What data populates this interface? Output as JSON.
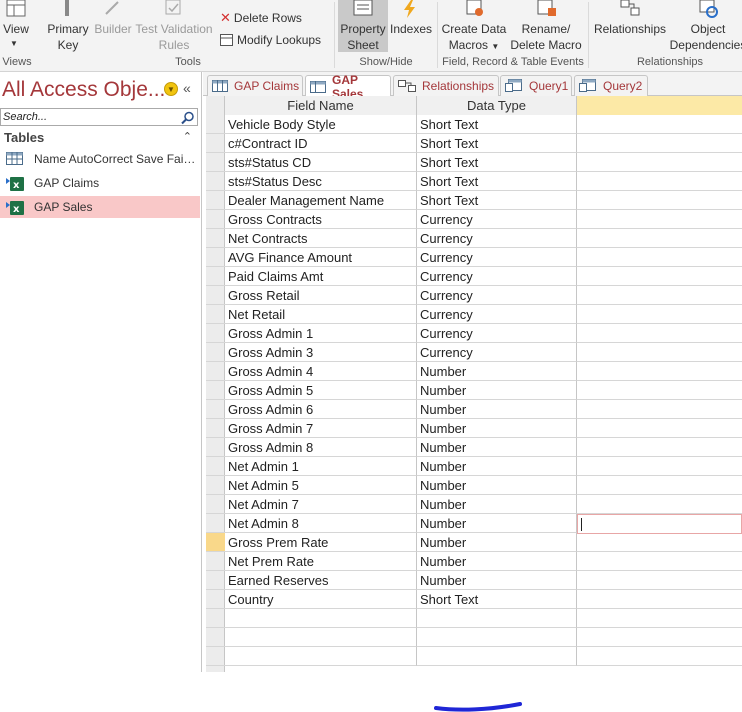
{
  "ribbon": {
    "view_label": "View",
    "primary_key_label1": "Primary",
    "primary_key_label2": "Key",
    "builder_label": "Builder",
    "test_validation_label1": "Test Validation",
    "test_validation_label2": "Rules",
    "delete_rows_label": "Delete Rows",
    "modify_lookups_label": "Modify Lookups",
    "property_sheet_label1": "Property",
    "property_sheet_label2": "Sheet",
    "indexes_label": "Indexes",
    "create_data_macros_label1": "Create Data",
    "create_data_macros_label2": "Macros",
    "rename_delete_macro_label1": "Rename/",
    "rename_delete_macro_label2": "Delete Macro",
    "relationships_label": "Relationships",
    "object_dependencies_label1": "Object",
    "object_dependencies_label2": "Dependencies",
    "groups": {
      "views": "Views",
      "tools": "Tools",
      "show_hide": "Show/Hide",
      "field_record_table_events": "Field, Record & Table Events",
      "relationships": "Relationships"
    }
  },
  "nav": {
    "title": "All Access Obje...",
    "search_placeholder": "Search...",
    "section_label": "Tables",
    "items": [
      {
        "label": "Name AutoCorrect Save Failu...",
        "selected": false
      },
      {
        "label": "GAP Claims",
        "selected": false
      },
      {
        "label": "GAP Sales",
        "selected": true
      }
    ]
  },
  "tabs": [
    {
      "label": "GAP Claims",
      "active": false
    },
    {
      "label": "GAP Sales",
      "active": true
    },
    {
      "label": "Relationships",
      "active": false
    },
    {
      "label": "Query1",
      "active": false
    },
    {
      "label": "Query2",
      "active": false
    }
  ],
  "grid": {
    "header": {
      "field_name": "Field Name",
      "data_type": "Data Type"
    },
    "rows": [
      {
        "field": "Vehicle Body Style",
        "type": "Short Text"
      },
      {
        "field": "c#Contract ID",
        "type": "Short Text"
      },
      {
        "field": "sts#Status CD",
        "type": "Short Text"
      },
      {
        "field": "sts#Status Desc",
        "type": "Short Text"
      },
      {
        "field": "Dealer Management Name",
        "type": "Short Text"
      },
      {
        "field": "Gross Contracts",
        "type": "Currency"
      },
      {
        "field": "Net Contracts",
        "type": "Currency"
      },
      {
        "field": "AVG Finance Amount",
        "type": "Currency"
      },
      {
        "field": "Paid Claims Amt",
        "type": "Currency"
      },
      {
        "field": "Gross Retail",
        "type": "Currency"
      },
      {
        "field": "Net Retail",
        "type": "Currency"
      },
      {
        "field": "Gross Admin 1",
        "type": "Currency"
      },
      {
        "field": "Gross Admin 3",
        "type": "Currency"
      },
      {
        "field": "Gross Admin 4",
        "type": "Number"
      },
      {
        "field": "Gross Admin 5",
        "type": "Number"
      },
      {
        "field": "Gross Admin 6",
        "type": "Number"
      },
      {
        "field": "Gross Admin 7",
        "type": "Number"
      },
      {
        "field": "Gross Admin 8",
        "type": "Number"
      },
      {
        "field": "Net Admin 1",
        "type": "Number"
      },
      {
        "field": "Net Admin 5",
        "type": "Number"
      },
      {
        "field": "Net Admin 7",
        "type": "Number"
      },
      {
        "field": "Net Admin 8",
        "type": "Number"
      },
      {
        "field": "Gross Prem Rate",
        "type": "Number"
      },
      {
        "field": "Net Prem Rate",
        "type": "Number"
      },
      {
        "field": "Earned Reserves",
        "type": "Number"
      },
      {
        "field": "Country",
        "type": "Short Text"
      },
      {
        "field": "",
        "type": ""
      },
      {
        "field": "",
        "type": ""
      },
      {
        "field": "",
        "type": ""
      }
    ],
    "current_row": 22
  },
  "colors": {
    "accent": "#a4373a",
    "selected_nav": "#f9c8c8",
    "annotation": "#1f26d6"
  }
}
